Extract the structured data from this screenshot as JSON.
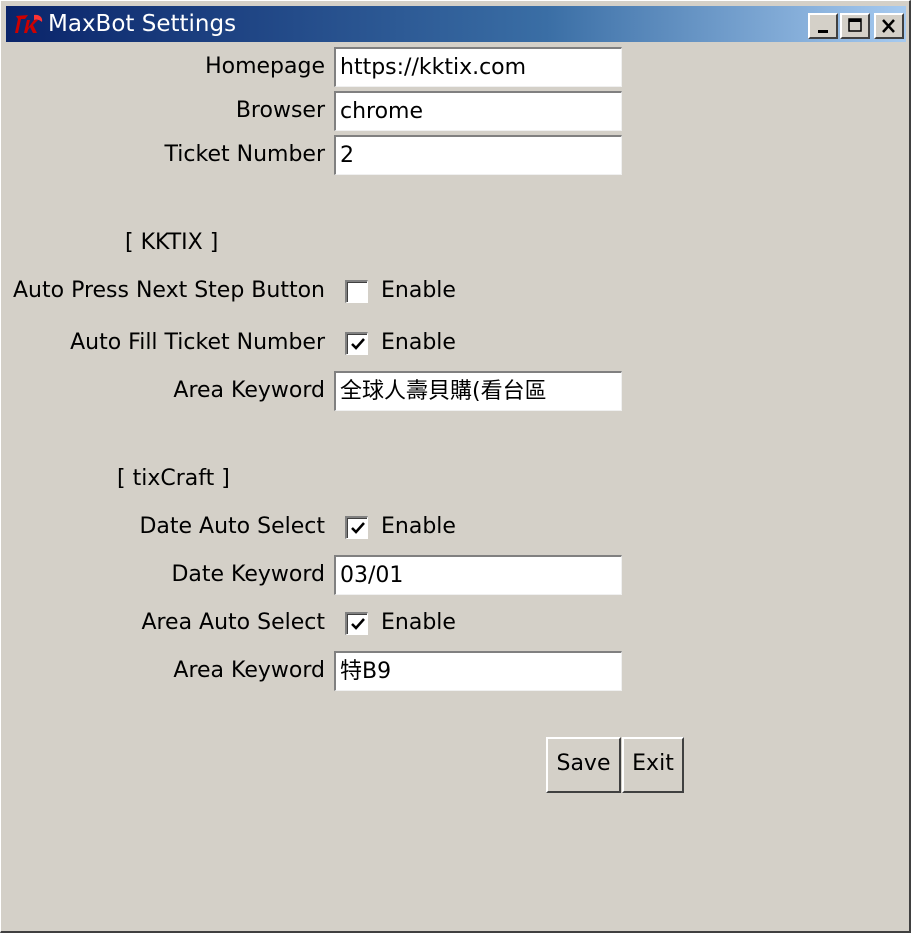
{
  "window": {
    "title": "MaxBot Settings",
    "icon": "tk-feather-icon",
    "controls": {
      "minimize": "minimize-icon",
      "maximize": "maximize-icon",
      "close": "close-icon"
    }
  },
  "general": {
    "homepage": {
      "label": "Homepage",
      "value": "https://kktix.com"
    },
    "browser": {
      "label": "Browser",
      "value": "chrome"
    },
    "ticket_number": {
      "label": "Ticket Number",
      "value": "2"
    }
  },
  "kktix": {
    "header": "[ KKTIX ]",
    "auto_press_next": {
      "label": "Auto Press Next Step Button",
      "option": "Enable",
      "checked": false
    },
    "auto_fill_ticket": {
      "label": "Auto Fill Ticket Number",
      "option": "Enable",
      "checked": true
    },
    "area_keyword": {
      "label": "Area Keyword",
      "value": "全球人壽貝購(看台區"
    }
  },
  "tixcraft": {
    "header": "[ tixCraft ]",
    "date_auto_select": {
      "label": "Date Auto Select",
      "option": "Enable",
      "checked": true
    },
    "date_keyword": {
      "label": "Date Keyword",
      "value": "03/01"
    },
    "area_auto_select": {
      "label": "Area Auto Select",
      "option": "Enable",
      "checked": true
    },
    "area_keyword": {
      "label": "Area Keyword",
      "value": "特B9"
    }
  },
  "actions": {
    "save": "Save",
    "exit": "Exit"
  },
  "colors": {
    "title_bar_start": "#0a246a",
    "title_bar_end": "#a6caf0",
    "background": "#d4d0c8"
  }
}
